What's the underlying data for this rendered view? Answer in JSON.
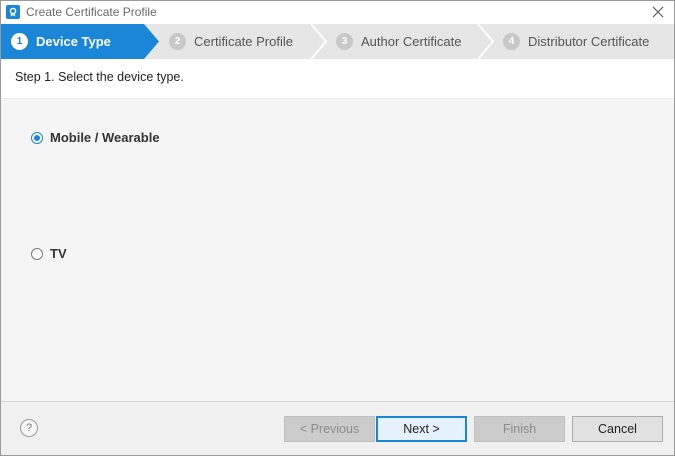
{
  "window": {
    "title": "Create Certificate Profile",
    "app_icon": "certificate-manager-icon",
    "close_icon": "close-icon"
  },
  "steps": [
    {
      "number": "1",
      "label": "Device Type",
      "state": "active"
    },
    {
      "number": "2",
      "label": "Certificate Profile",
      "state": "inactive"
    },
    {
      "number": "3",
      "label": "Author Certificate",
      "state": "inactive"
    },
    {
      "number": "4",
      "label": "Distributor Certificate",
      "state": "inactive"
    }
  ],
  "instruction": "Step 1. Select the device type.",
  "device_options": [
    {
      "label": "Mobile / Wearable",
      "selected": true
    },
    {
      "label": "TV",
      "selected": false
    }
  ],
  "footer": {
    "help_label": "?",
    "previous_label": "< Previous",
    "next_label": "Next >",
    "finish_label": "Finish",
    "cancel_label": "Cancel"
  },
  "colors": {
    "accent": "#1a86d8",
    "step_bar": "#e6e6e6",
    "content_bg": "#f5f5f5"
  }
}
